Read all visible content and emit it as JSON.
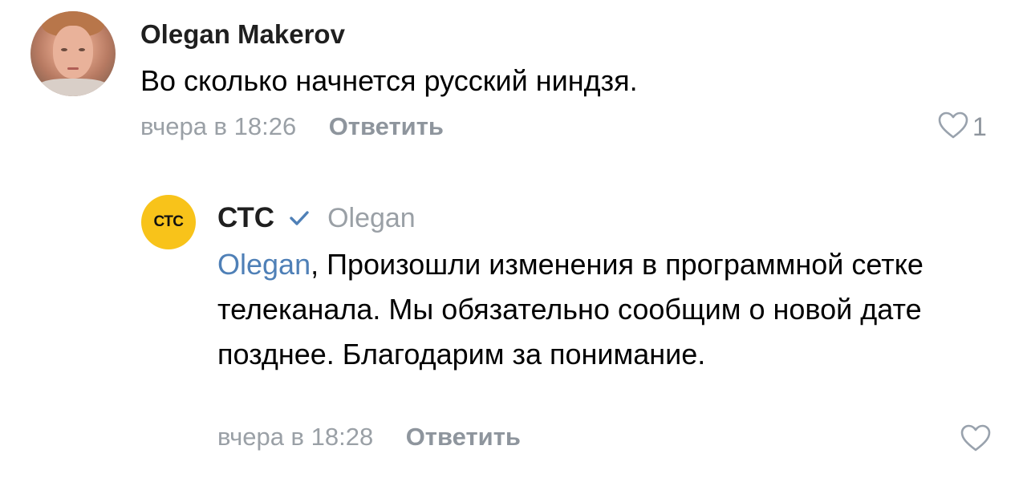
{
  "comment": {
    "author": "Olegan Makerov",
    "text": "Во сколько начнется русский ниндзя.",
    "time": "вчера в 18:26",
    "reply_label": "Ответить",
    "like_count": "1",
    "avatar_icon": "user-avatar-photo"
  },
  "reply": {
    "avatar_text": "СТС",
    "author": "СТС",
    "verified_icon": "checkmark-icon",
    "reply_to": "Olegan",
    "mention": "Olegan",
    "text": ", Произошли изменения в программной сетке телеканала. Мы обязательно сообщим о новой дате позднее. Благодарим за понимание.",
    "time": "вчера в 18:28",
    "reply_label": "Ответить"
  },
  "colors": {
    "link": "#4f80b7",
    "meta": "#9aa0a6",
    "brand": "#f8c31a",
    "verified": "#4f80b7"
  }
}
